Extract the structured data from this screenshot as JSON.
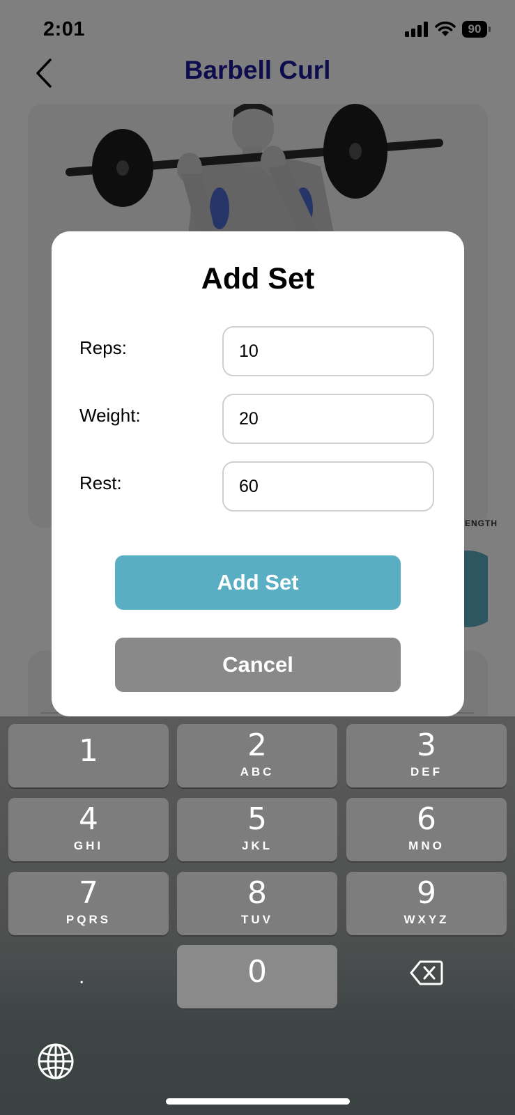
{
  "status_bar": {
    "time": "2:01",
    "battery": "90"
  },
  "header": {
    "title": "Barbell Curl"
  },
  "background": {
    "card_label": "STRENGTH"
  },
  "modal": {
    "title": "Add Set",
    "fields": [
      {
        "label": "Reps:",
        "value": "10"
      },
      {
        "label": "Weight:",
        "value": "20"
      },
      {
        "label": "Rest:",
        "value": "60"
      }
    ],
    "primary_button": "Add Set",
    "secondary_button": "Cancel"
  },
  "keyboard": {
    "keys": [
      {
        "digit": "1",
        "letters": ""
      },
      {
        "digit": "2",
        "letters": "ABC"
      },
      {
        "digit": "3",
        "letters": "DEF"
      },
      {
        "digit": "4",
        "letters": "GHI"
      },
      {
        "digit": "5",
        "letters": "JKL"
      },
      {
        "digit": "6",
        "letters": "MNO"
      },
      {
        "digit": "7",
        "letters": "PQRS"
      },
      {
        "digit": "8",
        "letters": "TUV"
      },
      {
        "digit": "9",
        "letters": "WXYZ"
      },
      {
        "digit": "0",
        "letters": ""
      }
    ],
    "decimal": ".",
    "icons": {
      "delete": "backspace-icon",
      "globe": "globe-icon"
    }
  },
  "colors": {
    "title_blue": "#1a1a9a",
    "accent_teal": "#5aaec3",
    "cancel_gray": "#898989",
    "key_gray": "#7d7d7d"
  }
}
